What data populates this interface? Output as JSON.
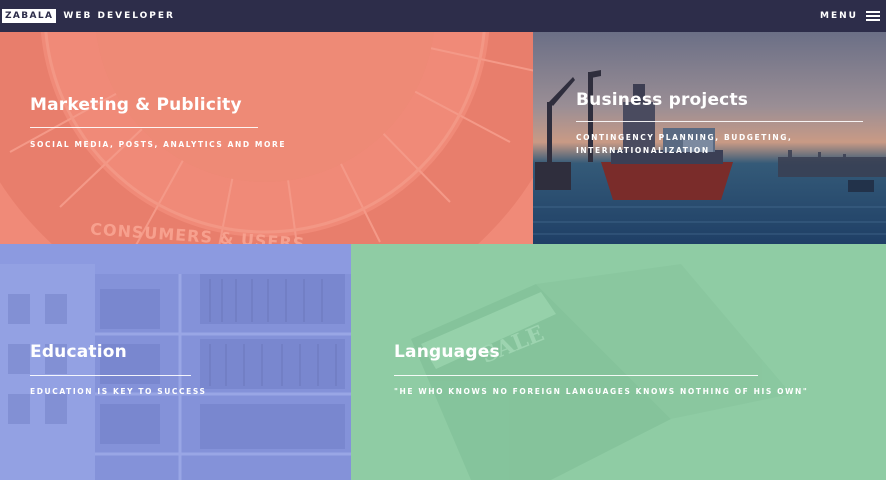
{
  "header": {
    "logo_text": "ZABALA",
    "tagline": "WEB DEVELOPER",
    "menu_label": "MENU"
  },
  "tiles": [
    {
      "title": "Marketing & Publicity",
      "subtitle": "SOCIAL MEDIA, POSTS, ANALYTICS AND MORE",
      "color": "#f08a78"
    },
    {
      "title": "Business projects",
      "subtitle": "CONTINGENCY PLANNING, BUDGETING, INTERNATIONALIZATION",
      "color": "#1f3f66"
    },
    {
      "title": "Education",
      "subtitle": "EDUCATION IS KEY TO SUCCESS",
      "color": "#8c9ae0"
    },
    {
      "title": "Languages",
      "subtitle": "\"HE WHO KNOWS NO FOREIGN LANGUAGES KNOWS NOTHING OF HIS OWN\"",
      "color": "#8fcca4"
    }
  ],
  "background_text": {
    "marketing_wheel": "CONSUMERS & USERS",
    "languages_book": "SALE"
  }
}
